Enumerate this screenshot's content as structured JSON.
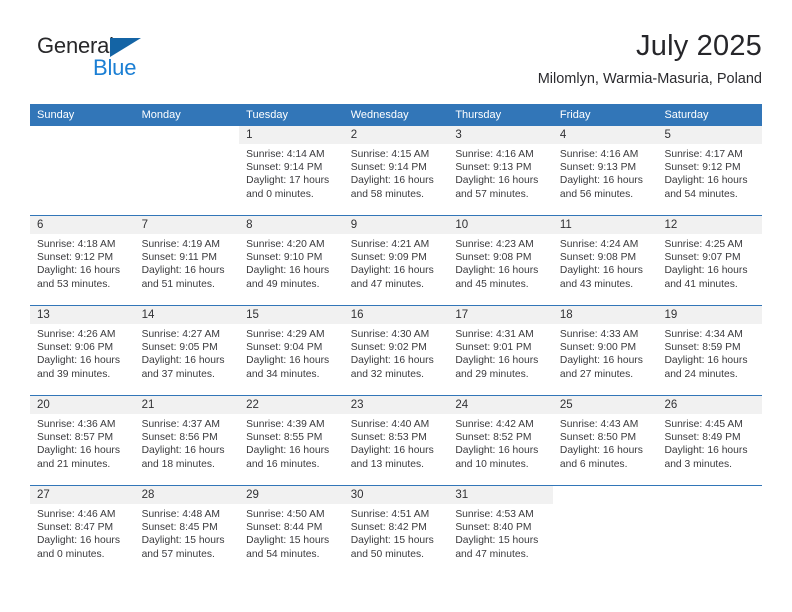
{
  "brand": {
    "line1": "General",
    "line2": "Blue",
    "triangle_color": "#1464a5",
    "line2_color": "#1b7fd4"
  },
  "header": {
    "title": "July 2025",
    "subtitle": "Milomlyn, Warmia-Masuria, Poland"
  },
  "theme": {
    "header_bar": "#3276b8",
    "daynum_band": "#f1f1f1",
    "separator": "#3276b8",
    "text": "#3a3a3d"
  },
  "weekdays": [
    "Sunday",
    "Monday",
    "Tuesday",
    "Wednesday",
    "Thursday",
    "Friday",
    "Saturday"
  ],
  "weeks": [
    [
      {
        "day": "",
        "lines": [
          "",
          "",
          "",
          ""
        ]
      },
      {
        "day": "",
        "lines": [
          "",
          "",
          "",
          ""
        ]
      },
      {
        "day": "1",
        "lines": [
          "Sunrise: 4:14 AM",
          "Sunset: 9:14 PM",
          "Daylight: 17 hours",
          "and 0 minutes."
        ]
      },
      {
        "day": "2",
        "lines": [
          "Sunrise: 4:15 AM",
          "Sunset: 9:14 PM",
          "Daylight: 16 hours",
          "and 58 minutes."
        ]
      },
      {
        "day": "3",
        "lines": [
          "Sunrise: 4:16 AM",
          "Sunset: 9:13 PM",
          "Daylight: 16 hours",
          "and 57 minutes."
        ]
      },
      {
        "day": "4",
        "lines": [
          "Sunrise: 4:16 AM",
          "Sunset: 9:13 PM",
          "Daylight: 16 hours",
          "and 56 minutes."
        ]
      },
      {
        "day": "5",
        "lines": [
          "Sunrise: 4:17 AM",
          "Sunset: 9:12 PM",
          "Daylight: 16 hours",
          "and 54 minutes."
        ]
      }
    ],
    [
      {
        "day": "6",
        "lines": [
          "Sunrise: 4:18 AM",
          "Sunset: 9:12 PM",
          "Daylight: 16 hours",
          "and 53 minutes."
        ]
      },
      {
        "day": "7",
        "lines": [
          "Sunrise: 4:19 AM",
          "Sunset: 9:11 PM",
          "Daylight: 16 hours",
          "and 51 minutes."
        ]
      },
      {
        "day": "8",
        "lines": [
          "Sunrise: 4:20 AM",
          "Sunset: 9:10 PM",
          "Daylight: 16 hours",
          "and 49 minutes."
        ]
      },
      {
        "day": "9",
        "lines": [
          "Sunrise: 4:21 AM",
          "Sunset: 9:09 PM",
          "Daylight: 16 hours",
          "and 47 minutes."
        ]
      },
      {
        "day": "10",
        "lines": [
          "Sunrise: 4:23 AM",
          "Sunset: 9:08 PM",
          "Daylight: 16 hours",
          "and 45 minutes."
        ]
      },
      {
        "day": "11",
        "lines": [
          "Sunrise: 4:24 AM",
          "Sunset: 9:08 PM",
          "Daylight: 16 hours",
          "and 43 minutes."
        ]
      },
      {
        "day": "12",
        "lines": [
          "Sunrise: 4:25 AM",
          "Sunset: 9:07 PM",
          "Daylight: 16 hours",
          "and 41 minutes."
        ]
      }
    ],
    [
      {
        "day": "13",
        "lines": [
          "Sunrise: 4:26 AM",
          "Sunset: 9:06 PM",
          "Daylight: 16 hours",
          "and 39 minutes."
        ]
      },
      {
        "day": "14",
        "lines": [
          "Sunrise: 4:27 AM",
          "Sunset: 9:05 PM",
          "Daylight: 16 hours",
          "and 37 minutes."
        ]
      },
      {
        "day": "15",
        "lines": [
          "Sunrise: 4:29 AM",
          "Sunset: 9:04 PM",
          "Daylight: 16 hours",
          "and 34 minutes."
        ]
      },
      {
        "day": "16",
        "lines": [
          "Sunrise: 4:30 AM",
          "Sunset: 9:02 PM",
          "Daylight: 16 hours",
          "and 32 minutes."
        ]
      },
      {
        "day": "17",
        "lines": [
          "Sunrise: 4:31 AM",
          "Sunset: 9:01 PM",
          "Daylight: 16 hours",
          "and 29 minutes."
        ]
      },
      {
        "day": "18",
        "lines": [
          "Sunrise: 4:33 AM",
          "Sunset: 9:00 PM",
          "Daylight: 16 hours",
          "and 27 minutes."
        ]
      },
      {
        "day": "19",
        "lines": [
          "Sunrise: 4:34 AM",
          "Sunset: 8:59 PM",
          "Daylight: 16 hours",
          "and 24 minutes."
        ]
      }
    ],
    [
      {
        "day": "20",
        "lines": [
          "Sunrise: 4:36 AM",
          "Sunset: 8:57 PM",
          "Daylight: 16 hours",
          "and 21 minutes."
        ]
      },
      {
        "day": "21",
        "lines": [
          "Sunrise: 4:37 AM",
          "Sunset: 8:56 PM",
          "Daylight: 16 hours",
          "and 18 minutes."
        ]
      },
      {
        "day": "22",
        "lines": [
          "Sunrise: 4:39 AM",
          "Sunset: 8:55 PM",
          "Daylight: 16 hours",
          "and 16 minutes."
        ]
      },
      {
        "day": "23",
        "lines": [
          "Sunrise: 4:40 AM",
          "Sunset: 8:53 PM",
          "Daylight: 16 hours",
          "and 13 minutes."
        ]
      },
      {
        "day": "24",
        "lines": [
          "Sunrise: 4:42 AM",
          "Sunset: 8:52 PM",
          "Daylight: 16 hours",
          "and 10 minutes."
        ]
      },
      {
        "day": "25",
        "lines": [
          "Sunrise: 4:43 AM",
          "Sunset: 8:50 PM",
          "Daylight: 16 hours",
          "and 6 minutes."
        ]
      },
      {
        "day": "26",
        "lines": [
          "Sunrise: 4:45 AM",
          "Sunset: 8:49 PM",
          "Daylight: 16 hours",
          "and 3 minutes."
        ]
      }
    ],
    [
      {
        "day": "27",
        "lines": [
          "Sunrise: 4:46 AM",
          "Sunset: 8:47 PM",
          "Daylight: 16 hours",
          "and 0 minutes."
        ]
      },
      {
        "day": "28",
        "lines": [
          "Sunrise: 4:48 AM",
          "Sunset: 8:45 PM",
          "Daylight: 15 hours",
          "and 57 minutes."
        ]
      },
      {
        "day": "29",
        "lines": [
          "Sunrise: 4:50 AM",
          "Sunset: 8:44 PM",
          "Daylight: 15 hours",
          "and 54 minutes."
        ]
      },
      {
        "day": "30",
        "lines": [
          "Sunrise: 4:51 AM",
          "Sunset: 8:42 PM",
          "Daylight: 15 hours",
          "and 50 minutes."
        ]
      },
      {
        "day": "31",
        "lines": [
          "Sunrise: 4:53 AM",
          "Sunset: 8:40 PM",
          "Daylight: 15 hours",
          "and 47 minutes."
        ]
      },
      {
        "day": "",
        "lines": [
          "",
          "",
          "",
          ""
        ]
      },
      {
        "day": "",
        "lines": [
          "",
          "",
          "",
          ""
        ]
      }
    ]
  ]
}
